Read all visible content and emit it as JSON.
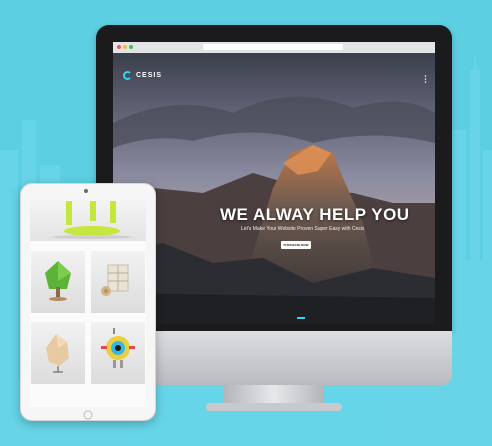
{
  "website": {
    "logo_text": "CESIS",
    "hero_title": "WE ALWAY HELP YOU",
    "hero_subtitle": "Let's Make Your Website Proven Super Easy with Cesis",
    "cta_label": "PURCHASE NOW"
  },
  "colors": {
    "background": "#5ccfe3",
    "accent": "#3ad0f0"
  },
  "icons": [
    "logo-icon",
    "menu-icon",
    "home-button-icon"
  ]
}
